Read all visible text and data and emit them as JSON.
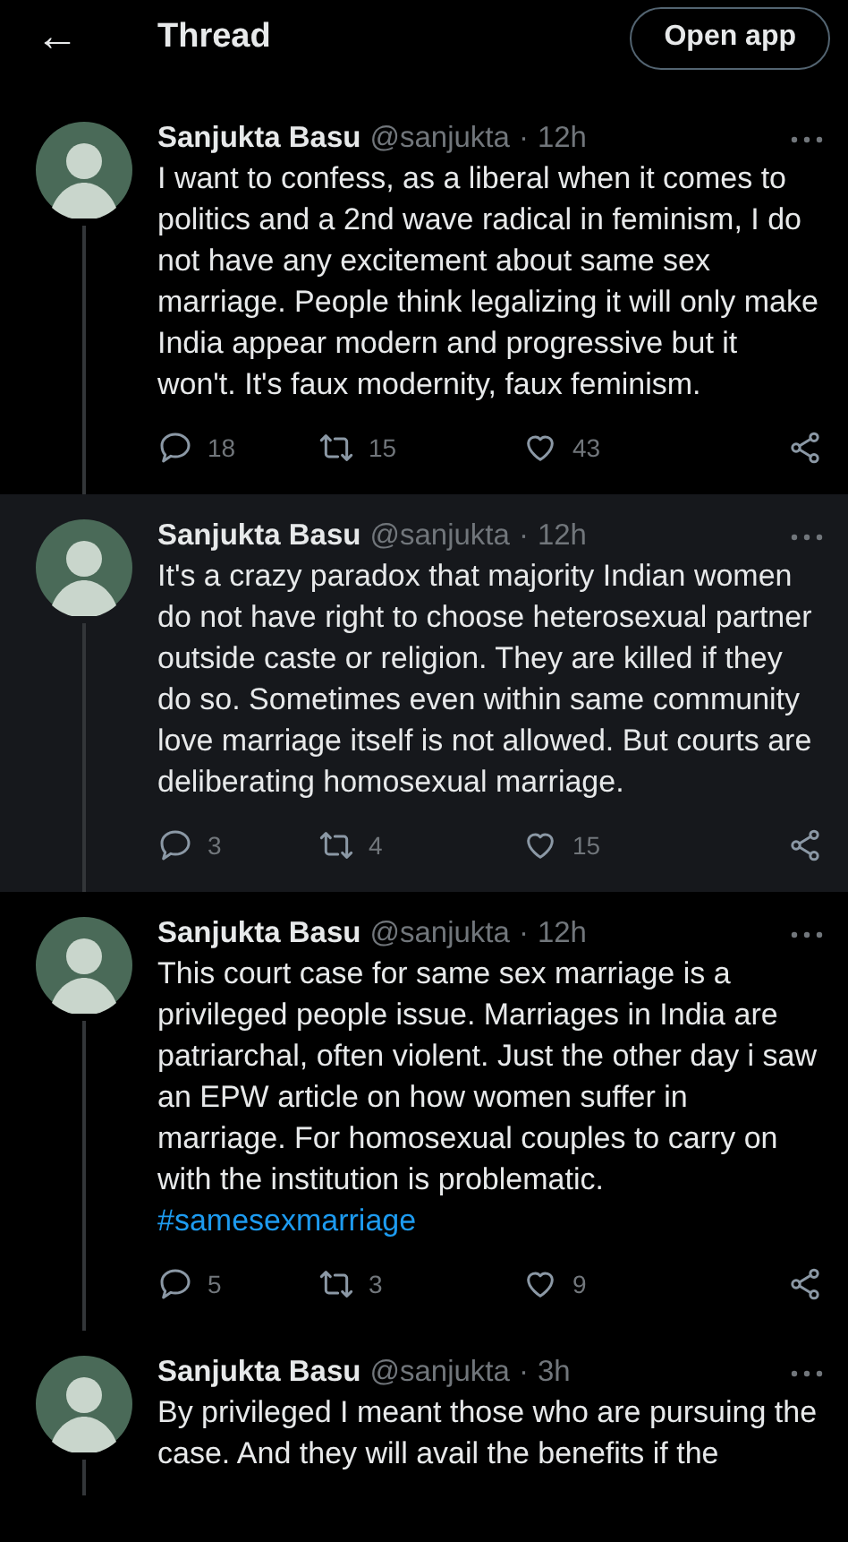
{
  "header": {
    "back": "←",
    "title": "Thread",
    "open_app": "Open app"
  },
  "separator": "·",
  "tweets": [
    {
      "name": "Sanjukta Basu",
      "handle": "@sanjukta",
      "time": "12h",
      "highlighted": false,
      "text": "I want to confess, as a liberal when it comes to politics and a 2nd wave radical in feminism, I do not have any excitement about same sex marriage. People think legalizing it will only make India appear modern and progressive but it won't. It's faux modernity, faux feminism.",
      "replies": "18",
      "retweets": "15",
      "likes": "43"
    },
    {
      "name": "Sanjukta Basu",
      "handle": "@sanjukta",
      "time": "12h",
      "highlighted": true,
      "text": "It's a crazy paradox that majority Indian women do not have right to choose heterosexual partner outside caste or religion. They are killed if they do so. Sometimes even within same community love marriage itself is not allowed. But courts are deliberating homosexual marriage.",
      "replies": "3",
      "retweets": "4",
      "likes": "15"
    },
    {
      "name": "Sanjukta Basu",
      "handle": "@sanjukta",
      "time": "12h",
      "highlighted": false,
      "text": "This court case for same sex marriage is a privileged people issue. Marriages in India are patriarchal, often violent. Just the other day i saw an EPW article on how women suffer in marriage. For homosexual couples to carry on with the institution is problematic.",
      "hashtag": "#samesexmarriage",
      "replies": "5",
      "retweets": "3",
      "likes": "9"
    },
    {
      "name": "Sanjukta Basu",
      "handle": "@sanjukta",
      "time": "3h",
      "highlighted": false,
      "text": "By privileged I meant those who are pursuing the case. And they will avail the benefits if the"
    }
  ]
}
